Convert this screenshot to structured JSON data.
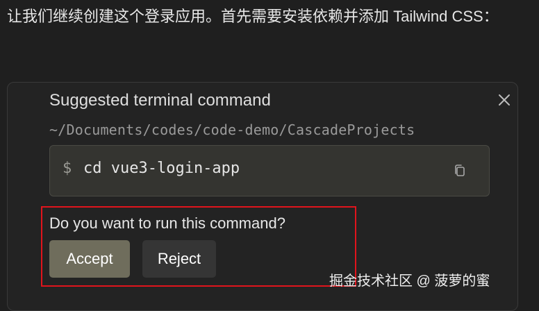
{
  "message": {
    "text": "让我们继续创建这个登录应用。首先需要安装依赖并添加 Tailwind CSS："
  },
  "suggestion": {
    "title": "Suggested terminal command",
    "cwd": "~/Documents/codes/code-demo/CascadeProjects",
    "prompt_symbol": "$",
    "command": "cd vue3-login-app",
    "question": "Do you want to run this command?",
    "accept_label": "Accept",
    "reject_label": "Reject",
    "close_icon": "close-icon",
    "copy_icon": "copy-icon"
  },
  "status": {
    "indicator_color": "#f2c20f"
  },
  "annotation": {
    "highlight_color": "#e1141c"
  },
  "watermark": {
    "text": "掘金技术社区 @ 菠萝的蜜"
  },
  "colors": {
    "background": "#1f1f1f",
    "card_background": "#232323",
    "command_box_background": "#343430",
    "accept_background": "#6f6d5c",
    "reject_background": "#353535"
  }
}
